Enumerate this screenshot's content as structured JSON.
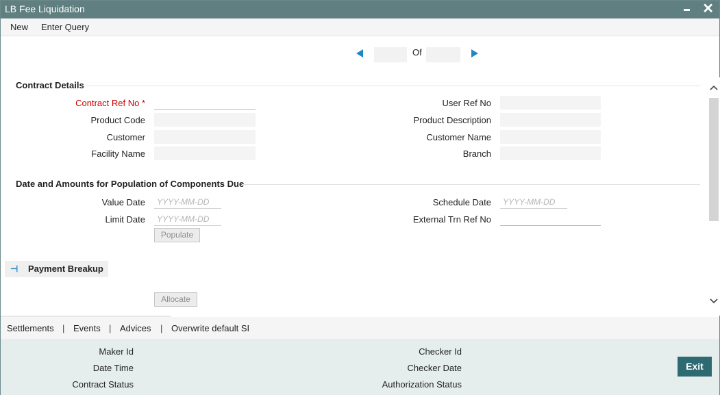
{
  "window": {
    "title": "LB Fee Liquidation"
  },
  "menu": {
    "new": "New",
    "enter_query": "Enter Query"
  },
  "pager": {
    "of_label": "Of",
    "current": "",
    "total": ""
  },
  "contract_details": {
    "heading": "Contract Details",
    "contract_ref_no": {
      "label": "Contract Ref No",
      "required_mark": "*",
      "value": ""
    },
    "product_code": {
      "label": "Product Code",
      "value": ""
    },
    "customer": {
      "label": "Customer",
      "value": ""
    },
    "facility_name": {
      "label": "Facility Name",
      "value": ""
    },
    "user_ref_no": {
      "label": "User Ref No",
      "value": ""
    },
    "product_description": {
      "label": "Product Description",
      "value": ""
    },
    "customer_name": {
      "label": "Customer Name",
      "value": ""
    },
    "branch": {
      "label": "Branch",
      "value": ""
    }
  },
  "dates_amounts": {
    "heading": "Date and Amounts for Population of Components Due",
    "value_date": {
      "label": "Value Date",
      "placeholder": "YYYY-MM-DD"
    },
    "limit_date": {
      "label": "Limit Date",
      "placeholder": "YYYY-MM-DD"
    },
    "schedule_date": {
      "label": "Schedule Date",
      "placeholder": "YYYY-MM-DD"
    },
    "external_trn_ref_no": {
      "label": "External Trn Ref No",
      "value": ""
    },
    "populate_button": "Populate"
  },
  "payment_breakup": {
    "label": "Payment Breakup",
    "allocate_button": "Allocate"
  },
  "bottom_tabs": [
    "Settlements",
    "Events",
    "Advices",
    "Overwrite default SI"
  ],
  "bottom_tab_separator": "|",
  "footer": {
    "maker_id": "Maker Id",
    "date_time": "Date Time",
    "contract_status": "Contract Status",
    "checker_id": "Checker Id",
    "checker_date": "Checker Date",
    "authorization_status": "Authorization Status",
    "exit_button": "Exit"
  },
  "colors": {
    "titlebar": "#5f7f81",
    "accent": "#1e88c7",
    "required": "#cc0000",
    "exit": "#2e6a72"
  }
}
